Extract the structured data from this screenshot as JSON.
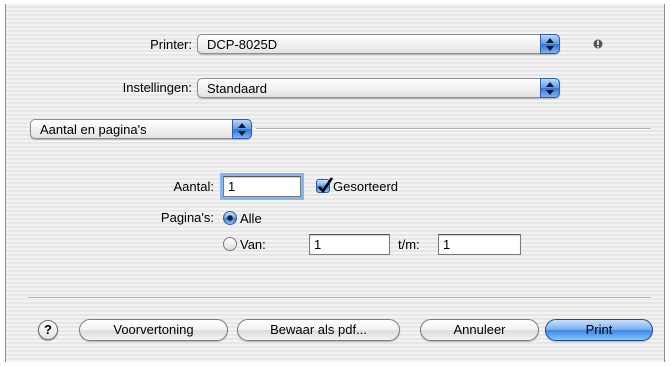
{
  "printer": {
    "label": "Printer:",
    "value": "DCP-8025D"
  },
  "presets": {
    "label": "Instellingen:",
    "value": "Standaard"
  },
  "panel": {
    "value": "Aantal en pagina's"
  },
  "copies": {
    "label": "Aantal:",
    "value": "1",
    "collated_label": "Gesorteerd",
    "collated_checked": true
  },
  "pages": {
    "label": "Pagina's:",
    "all_label": "Alle",
    "range_label": "Van:",
    "from_value": "1",
    "to_label": "t/m:",
    "to_value": "1",
    "selected": "Alle"
  },
  "buttons": {
    "help": "?",
    "preview": "Voorvertoning",
    "save_pdf": "Bewaar als pdf...",
    "cancel": "Annuleer",
    "print": "Print"
  },
  "colors": {
    "accent": "#3a86e3"
  }
}
